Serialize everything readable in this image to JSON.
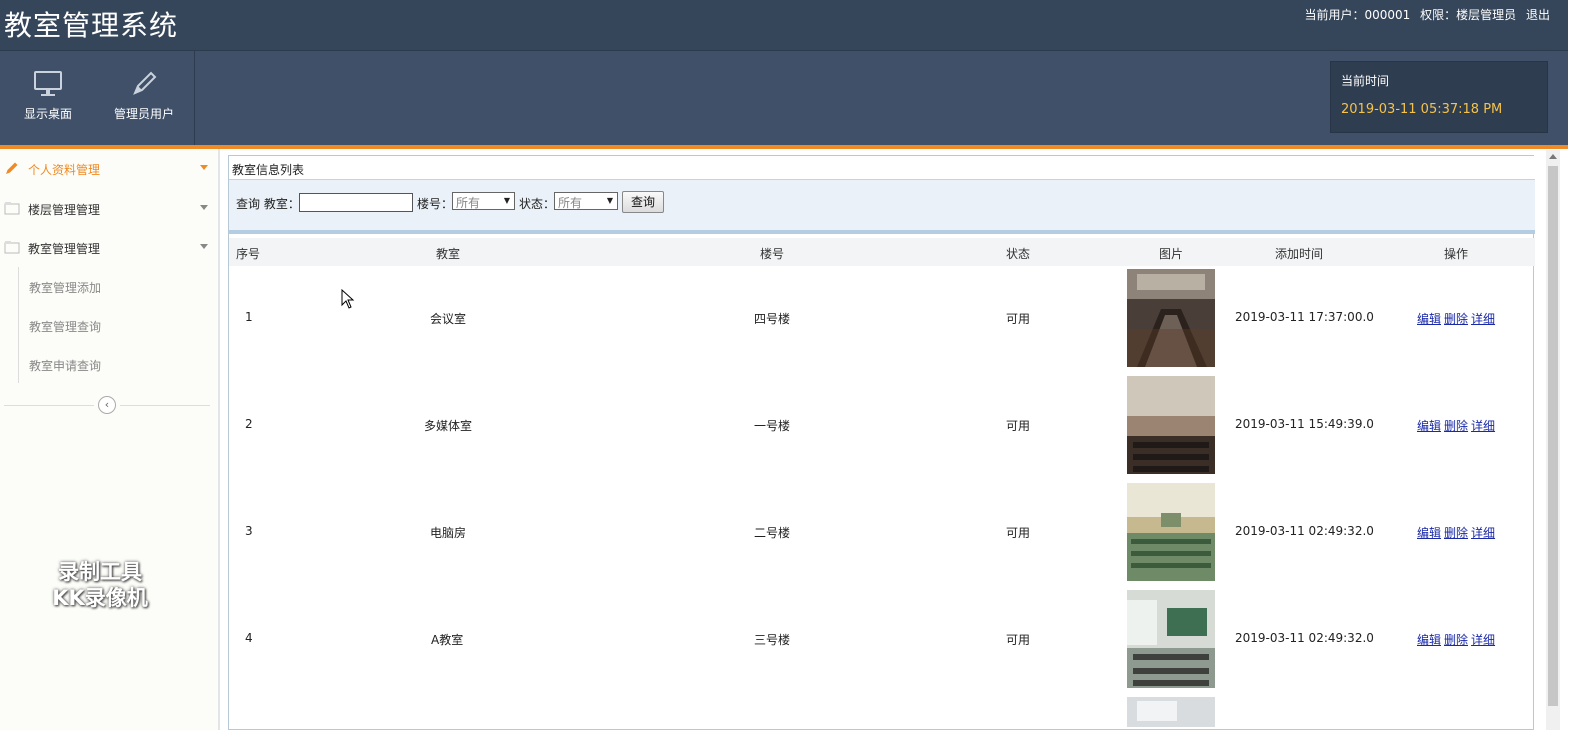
{
  "app": {
    "title": "教室管理系统"
  },
  "userinfo": {
    "current_user": "当前用户：000001",
    "role": "权限：楼层管理员",
    "logout": "退出"
  },
  "toolbar": {
    "items": [
      {
        "label": "显示桌面",
        "icon": "monitor-icon"
      },
      {
        "label": "管理员用户",
        "icon": "pencil-icon"
      }
    ],
    "clock_label": "当前时间",
    "clock_value": "2019-03-11 05:37:18 PM"
  },
  "sidebar": {
    "menus": [
      {
        "label": "个人资料管理",
        "icon": "edit-icon",
        "active": true
      },
      {
        "label": "楼层管理管理",
        "icon": "folder-icon",
        "active": false
      },
      {
        "label": "教室管理管理",
        "icon": "folder-icon",
        "active": false
      }
    ],
    "submenu": [
      "教室管理添加",
      "教室管理查询",
      "教室申请查询"
    ],
    "watermark_line1": "录制工具",
    "watermark_line2": "KK录像机"
  },
  "panel": {
    "title": "教室信息列表"
  },
  "query": {
    "prefix": "查询 教室：",
    "classroom_value": "",
    "building_label": "楼号：",
    "building_selected": "所有",
    "status_label": "状态：",
    "status_selected": "所有",
    "button": "查询"
  },
  "table": {
    "headers": [
      "序号",
      "教室",
      "楼号",
      "状态",
      "图片",
      "添加时间",
      "操作"
    ],
    "rows": [
      {
        "no": "1",
        "room": "会议室",
        "building": "四号楼",
        "status": "可用",
        "time": "2019-03-11 17:37:00.0"
      },
      {
        "no": "2",
        "room": "多媒体室",
        "building": "一号楼",
        "status": "可用",
        "time": "2019-03-11 15:49:39.0"
      },
      {
        "no": "3",
        "room": "电脑房",
        "building": "二号楼",
        "status": "可用",
        "time": "2019-03-11 02:49:32.0"
      },
      {
        "no": "4",
        "room": "A教室",
        "building": "三号楼",
        "status": "可用",
        "time": "2019-03-11 02:49:32.0"
      }
    ],
    "ops": {
      "edit": "编辑",
      "delete": "删除",
      "detail": "详细"
    }
  },
  "colors": {
    "header_bg": "#35455a",
    "toolbar_bg": "#3f5068",
    "accent": "#f08a24",
    "clock_text": "#f5c34a",
    "link": "#1a29a8"
  }
}
